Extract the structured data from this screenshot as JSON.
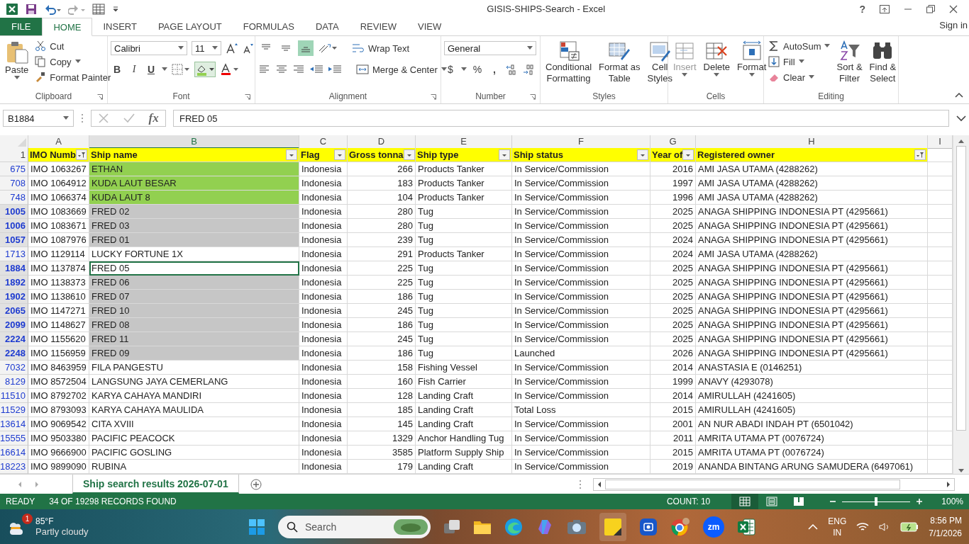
{
  "window": {
    "title": "GISIS-SHIPS-Search - Excel",
    "help": "?",
    "sign_in": "Sign in"
  },
  "tabs": [
    {
      "label": "FILE",
      "kind": "file",
      "selected": false
    },
    {
      "label": "HOME",
      "kind": "tab",
      "selected": true
    },
    {
      "label": "INSERT",
      "kind": "tab",
      "selected": false
    },
    {
      "label": "PAGE LAYOUT",
      "kind": "tab",
      "selected": false
    },
    {
      "label": "FORMULAS",
      "kind": "tab",
      "selected": false
    },
    {
      "label": "DATA",
      "kind": "tab",
      "selected": false
    },
    {
      "label": "REVIEW",
      "kind": "tab",
      "selected": false
    },
    {
      "label": "VIEW",
      "kind": "tab",
      "selected": false
    }
  ],
  "ribbon": {
    "clipboard": {
      "label": "Clipboard",
      "paste": "Paste",
      "cut": "Cut",
      "copy": "Copy",
      "format_painter": "Format Painter"
    },
    "font": {
      "label": "Font",
      "font_name": "Calibri",
      "font_size": "11",
      "bold": "B",
      "italic": "I",
      "underline": "U"
    },
    "alignment": {
      "label": "Alignment",
      "vertical": [
        {
          "kind": "top",
          "selected": false
        },
        {
          "kind": "middle",
          "selected": false
        },
        {
          "kind": "bottom",
          "selected": true
        }
      ],
      "wrap_text": "Wrap Text",
      "merge_center": "Merge & Center"
    },
    "number": {
      "label": "Number",
      "format": "General",
      "currency": "$",
      "percent": "%",
      "comma": ","
    },
    "styles": {
      "label": "Styles",
      "buttons": [
        {
          "kind": "conditional",
          "lines": [
            "Conditional",
            "Formatting"
          ]
        },
        {
          "kind": "table",
          "lines": [
            "Format as",
            "Table"
          ]
        },
        {
          "kind": "cellstyles",
          "lines": [
            "Cell",
            "Styles"
          ]
        }
      ]
    },
    "cells": {
      "label": "Cells",
      "buttons": [
        {
          "kind": "insert",
          "label": "Insert",
          "disabled": true
        },
        {
          "kind": "delete",
          "label": "Delete",
          "disabled": false
        },
        {
          "kind": "format",
          "label": "Format",
          "disabled": false
        }
      ]
    },
    "editing": {
      "label": "Editing",
      "autosum": "AutoSum",
      "fill": "Fill",
      "clear": "Clear",
      "sort_filter": [
        "Sort &",
        "Filter"
      ],
      "find_select": [
        "Find &",
        "Select"
      ]
    }
  },
  "formula_bar": {
    "name_box": "B1884",
    "fx": "fx",
    "value": "FRED 05"
  },
  "sheet": {
    "corner_row": "1",
    "columns": [
      {
        "letter": "A",
        "selected": false
      },
      {
        "letter": "B",
        "selected": true
      },
      {
        "letter": "C",
        "selected": false
      },
      {
        "letter": "D",
        "selected": false
      },
      {
        "letter": "E",
        "selected": false
      },
      {
        "letter": "F",
        "selected": false
      },
      {
        "letter": "G",
        "selected": false
      },
      {
        "letter": "H",
        "selected": false
      },
      {
        "letter": "I",
        "selected": false
      }
    ],
    "headers": [
      {
        "label": "IMO Numb",
        "filtered": true
      },
      {
        "label": "Ship name",
        "filtered": false
      },
      {
        "label": "Flag",
        "filtered": false
      },
      {
        "label": "Gross tonna",
        "filtered": false
      },
      {
        "label": "Ship type",
        "filtered": false
      },
      {
        "label": "Ship status",
        "filtered": false
      },
      {
        "label": "Year of",
        "filtered": false
      },
      {
        "label": "Registered owner",
        "filtered": true
      }
    ],
    "rows": [
      {
        "row_number": "675",
        "selected": false,
        "active": false,
        "color": "#92d050",
        "cells": [
          "IMO 1063267",
          "ETHAN",
          "Indonesia",
          "266",
          "Products Tanker",
          "In Service/Commission",
          "2016",
          "AMI JASA UTAMA (4288262)"
        ]
      },
      {
        "row_number": "708",
        "selected": false,
        "active": false,
        "color": "#92d050",
        "cells": [
          "IMO 1064912",
          "KUDA LAUT BESAR",
          "Indonesia",
          "183",
          "Products Tanker",
          "In Service/Commission",
          "1997",
          "AMI JASA UTAMA (4288262)"
        ]
      },
      {
        "row_number": "748",
        "selected": false,
        "active": false,
        "color": "#92d050",
        "cells": [
          "IMO 1066374",
          "KUDA LAUT 8",
          "Indonesia",
          "104",
          "Products Tanker",
          "In Service/Commission",
          "1996",
          "AMI JASA UTAMA (4288262)"
        ]
      },
      {
        "row_number": "1005",
        "selected": true,
        "active": false,
        "cells": [
          "IMO 1083669",
          "FRED 02",
          "Indonesia",
          "280",
          "Tug",
          "In Service/Commission",
          "2025",
          "ANAGA SHIPPING INDONESIA PT (4295661)"
        ]
      },
      {
        "row_number": "1006",
        "selected": true,
        "active": false,
        "cells": [
          "IMO 1083671",
          "FRED 03",
          "Indonesia",
          "280",
          "Tug",
          "In Service/Commission",
          "2025",
          "ANAGA SHIPPING INDONESIA PT (4295661)"
        ]
      },
      {
        "row_number": "1057",
        "selected": true,
        "active": false,
        "cells": [
          "IMO 1087976",
          "FRED 01",
          "Indonesia",
          "239",
          "Tug",
          "In Service/Commission",
          "2024",
          "ANAGA SHIPPING INDONESIA PT (4295661)"
        ]
      },
      {
        "row_number": "1713",
        "selected": false,
        "active": false,
        "cells": [
          "IMO 1129114",
          "LUCKY FORTUNE 1X",
          "Indonesia",
          "291",
          "Products Tanker",
          "In Service/Commission",
          "2024",
          "AMI JASA UTAMA (4288262)"
        ]
      },
      {
        "row_number": "1884",
        "selected": true,
        "active": true,
        "cells": [
          "IMO 1137874",
          "FRED 05",
          "Indonesia",
          "225",
          "Tug",
          "In Service/Commission",
          "2025",
          "ANAGA SHIPPING INDONESIA PT (4295661)"
        ]
      },
      {
        "row_number": "1892",
        "selected": true,
        "active": false,
        "cells": [
          "IMO 1138373",
          "FRED 06",
          "Indonesia",
          "225",
          "Tug",
          "In Service/Commission",
          "2025",
          "ANAGA SHIPPING INDONESIA PT (4295661)"
        ]
      },
      {
        "row_number": "1902",
        "selected": true,
        "active": false,
        "cells": [
          "IMO 1138610",
          "FRED 07",
          "Indonesia",
          "186",
          "Tug",
          "In Service/Commission",
          "2025",
          "ANAGA SHIPPING INDONESIA PT (4295661)"
        ]
      },
      {
        "row_number": "2065",
        "selected": true,
        "active": false,
        "cells": [
          "IMO 1147271",
          "FRED 10",
          "Indonesia",
          "245",
          "Tug",
          "In Service/Commission",
          "2025",
          "ANAGA SHIPPING INDONESIA PT (4295661)"
        ]
      },
      {
        "row_number": "2099",
        "selected": true,
        "active": false,
        "cells": [
          "IMO 1148627",
          "FRED 08",
          "Indonesia",
          "186",
          "Tug",
          "In Service/Commission",
          "2025",
          "ANAGA SHIPPING INDONESIA PT (4295661)"
        ]
      },
      {
        "row_number": "2224",
        "selected": true,
        "active": false,
        "cells": [
          "IMO 1155620",
          "FRED 11",
          "Indonesia",
          "245",
          "Tug",
          "In Service/Commission",
          "2025",
          "ANAGA SHIPPING INDONESIA PT (4295661)"
        ]
      },
      {
        "row_number": "2248",
        "selected": true,
        "active": false,
        "cells": [
          "IMO 1156959",
          "FRED 09",
          "Indonesia",
          "186",
          "Tug",
          "Launched",
          "2026",
          "ANAGA SHIPPING INDONESIA PT (4295661)"
        ]
      },
      {
        "row_number": "7032",
        "selected": false,
        "active": false,
        "cells": [
          "IMO 8463959",
          "FILA PANGESTU",
          "Indonesia",
          "158",
          "Fishing Vessel",
          "In Service/Commission",
          "2014",
          "ANASTASIA E (0146251)"
        ]
      },
      {
        "row_number": "8129",
        "selected": false,
        "active": false,
        "cells": [
          "IMO 8572504",
          "LANGSUNG JAYA CEMERLANG",
          "Indonesia",
          "160",
          "Fish Carrier",
          "In Service/Commission",
          "1999",
          "ANAVY (4293078)"
        ]
      },
      {
        "row_number": "11510",
        "selected": false,
        "active": false,
        "cells": [
          "IMO 8792702",
          "KARYA CAHAYA MANDIRI",
          "Indonesia",
          "128",
          "Landing Craft",
          "In Service/Commission",
          "2014",
          "AMIRULLAH (4241605)"
        ]
      },
      {
        "row_number": "11529",
        "selected": false,
        "active": false,
        "cells": [
          "IMO 8793093",
          "KARYA CAHAYA MAULIDA",
          "Indonesia",
          "185",
          "Landing Craft",
          "Total Loss",
          "2015",
          "AMIRULLAH (4241605)"
        ]
      },
      {
        "row_number": "13614",
        "selected": false,
        "active": false,
        "cells": [
          "IMO 9069542",
          "CITA XVIII",
          "Indonesia",
          "145",
          "Landing Craft",
          "In Service/Commission",
          "2001",
          "AN NUR ABADI INDAH PT (6501042)"
        ]
      },
      {
        "row_number": "15555",
        "selected": false,
        "active": false,
        "cells": [
          "IMO 9503380",
          "PACIFIC PEACOCK",
          "Indonesia",
          "1329",
          "Anchor Handling Tug",
          "In Service/Commission",
          "2011",
          "AMRITA UTAMA PT (0076724)"
        ]
      },
      {
        "row_number": "16614",
        "selected": false,
        "active": false,
        "cells": [
          "IMO 9666900",
          "PACIFIC GOSLING",
          "Indonesia",
          "3585",
          "Platform Supply Ship",
          "In Service/Commission",
          "2015",
          "AMRITA UTAMA PT (0076724)"
        ]
      },
      {
        "row_number": "18223",
        "selected": false,
        "active": false,
        "cells": [
          "IMO 9899090",
          "RUBINA",
          "Indonesia",
          "179",
          "Landing Craft",
          "In Service/Commission",
          "2019",
          "ANANDA BINTANG ARUNG SAMUDERA (6497061)"
        ]
      }
    ]
  },
  "sheet_tabs": [
    {
      "label": "Ship search results 2026-07-01",
      "selected": true
    }
  ],
  "status_bar": {
    "mode": "READY",
    "message": "34 OF 19298 RECORDS FOUND",
    "count": "COUNT: 10",
    "views": [
      {
        "kind": "normal",
        "selected": true
      },
      {
        "kind": "layout",
        "selected": false
      },
      {
        "kind": "pagebreak",
        "selected": false
      }
    ],
    "zoom_slider": {
      "level": 0.5
    },
    "zoom": "100%"
  },
  "taskbar": {
    "weather_badge": "1",
    "temperature": "85°F",
    "condition": "Partly cloudy",
    "search_placeholder": "Search",
    "zoom_app_label": "zm",
    "language": "ENG",
    "region": "IN",
    "time": "8:56 PM",
    "date": "7/1/2026"
  }
}
